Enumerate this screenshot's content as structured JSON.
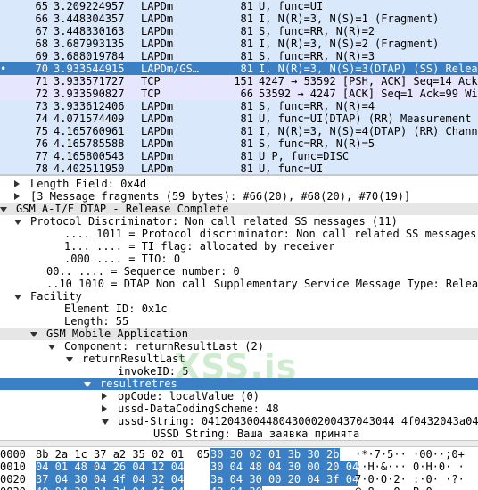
{
  "packets": [
    {
      "no": "65",
      "time": "3.209224957",
      "protocol": "LAPDm",
      "length": "81",
      "info": "U, func=UI",
      "style": "lapd"
    },
    {
      "no": "66",
      "time": "3.448304357",
      "protocol": "LAPDm",
      "length": "81",
      "info": "I, N(R)=3, N(S)=1 (Fragment)",
      "style": "lapd"
    },
    {
      "no": "67",
      "time": "3.448330163",
      "protocol": "LAPDm",
      "length": "81",
      "info": "S, func=RR, N(R)=2",
      "style": "lapd"
    },
    {
      "no": "68",
      "time": "3.687993135",
      "protocol": "LAPDm",
      "length": "81",
      "info": "I, N(R)=3, N(S)=2 (Fragment)",
      "style": "lapd"
    },
    {
      "no": "69",
      "time": "3.688019784",
      "protocol": "LAPDm",
      "length": "81",
      "info": "S, func=RR, N(R)=3",
      "style": "lapd"
    },
    {
      "no": "70",
      "time": "3.933544915",
      "protocol": "LAPDm/GS…",
      "length": "81",
      "info": "I, N(R)=3, N(S)=3(DTAP) (SS) Release Complete",
      "style": "sel",
      "mark": "•"
    },
    {
      "no": "71",
      "time": "3.933571727",
      "protocol": "TCP",
      "length": "151",
      "info": "4247 → 53592 [PSH, ACK] Seq=14 Ack=1",
      "style": "tcp"
    },
    {
      "no": "72",
      "time": "3.933590827",
      "protocol": "TCP",
      "length": "66",
      "info": "53592 → 4247 [ACK] Seq=1 Ack=99 Win=",
      "style": "tcp"
    },
    {
      "no": "73",
      "time": "3.933612406",
      "protocol": "LAPDm",
      "length": "81",
      "info": "S, func=RR, N(R)=4",
      "style": "lapd"
    },
    {
      "no": "74",
      "time": "4.071574409",
      "protocol": "LAPDm",
      "length": "81",
      "info": "U, func=UI(DTAP) (RR) Measurement Re",
      "style": "lapd"
    },
    {
      "no": "75",
      "time": "4.165760961",
      "protocol": "LAPDm",
      "length": "81",
      "info": "I, N(R)=3, N(S)=4(DTAP) (RR) Channel",
      "style": "lapd"
    },
    {
      "no": "76",
      "time": "4.165785588",
      "protocol": "LAPDm",
      "length": "81",
      "info": "S, func=RR, N(R)=5",
      "style": "lapd"
    },
    {
      "no": "77",
      "time": "4.165800543",
      "protocol": "LAPDm",
      "length": "81",
      "info": "U P, func=DISC",
      "style": "lapd"
    },
    {
      "no": "78",
      "time": "4.402511950",
      "protocol": "LAPDm",
      "length": "81",
      "info": "U, func=UI",
      "style": "lapd"
    }
  ],
  "tree": [
    {
      "indent": 16,
      "toggle": "collapsed",
      "text": "Length Field: 0x4d",
      "style": "field",
      "name": "tree-item-length-field"
    },
    {
      "indent": 16,
      "toggle": "collapsed",
      "text": "[3 Message fragments (59 bytes): #66(20), #68(20), #70(19)]",
      "style": "field",
      "name": "tree-item-message-fragments"
    },
    {
      "indent": 0,
      "toggle": "expanded",
      "text": "GSM A-I/F DTAP - Release Complete",
      "style": "sub",
      "name": "tree-item-gsm-dtap"
    },
    {
      "indent": 16,
      "toggle": "expanded",
      "text": "Protocol Discriminator: Non call related SS messages (11)",
      "style": "field",
      "name": "tree-item-protocol-discriminator"
    },
    {
      "indent": 54,
      "toggle": "none",
      "text": ".... 1011 = Protocol discriminator: Non call related SS messages (0",
      "style": "field",
      "name": "tree-item-pd-bits"
    },
    {
      "indent": 54,
      "toggle": "none",
      "text": "1... .... = TI flag: allocated by receiver",
      "style": "field",
      "name": "tree-item-ti-flag"
    },
    {
      "indent": 54,
      "toggle": "none",
      "text": ".000 .... = TIO: 0",
      "style": "field",
      "name": "tree-item-tio"
    },
    {
      "indent": 34,
      "toggle": "none",
      "text": "00.. .... = Sequence number: 0",
      "style": "field",
      "name": "tree-item-sequence-number"
    },
    {
      "indent": 34,
      "toggle": "none",
      "text": "..10 1010 = DTAP Non call Supplementary Service Message Type: Release",
      "style": "field",
      "name": "tree-item-message-type"
    },
    {
      "indent": 16,
      "toggle": "expanded",
      "text": "Facility",
      "style": "field",
      "name": "tree-item-facility"
    },
    {
      "indent": 54,
      "toggle": "none",
      "text": "Element ID: 0x1c",
      "style": "field",
      "name": "tree-item-element-id"
    },
    {
      "indent": 54,
      "toggle": "none",
      "text": "Length: 55",
      "style": "field",
      "name": "tree-item-length"
    },
    {
      "indent": 34,
      "toggle": "expanded",
      "text": "GSM Mobile Application",
      "style": "sub",
      "name": "tree-item-gsm-map"
    },
    {
      "indent": 54,
      "toggle": "expanded",
      "text": "Component: returnResultLast (2)",
      "style": "field",
      "name": "tree-item-component"
    },
    {
      "indent": 74,
      "toggle": "expanded",
      "text": "returnResultLast",
      "style": "field",
      "name": "tree-item-return-result-last"
    },
    {
      "indent": 114,
      "toggle": "none",
      "text": "invokeID: 5",
      "style": "field",
      "name": "tree-item-invoke-id"
    },
    {
      "indent": 94,
      "toggle": "expanded",
      "text": "resultretres",
      "style": "sel",
      "name": "tree-item-resultretres"
    },
    {
      "indent": 114,
      "toggle": "collapsed",
      "text": "opCode: localValue (0)",
      "style": "field",
      "name": "tree-item-opcode"
    },
    {
      "indent": 114,
      "toggle": "collapsed",
      "text": "ussd-DataCodingScheme: 48",
      "style": "field",
      "name": "tree-item-ussd-dcs"
    },
    {
      "indent": 114,
      "toggle": "expanded",
      "text": "ussd-String: 041204300448043000200437043044 4f0432043a043",
      "style": "field",
      "name": "tree-item-ussd-string"
    },
    {
      "indent": 154,
      "toggle": "none",
      "text": "USSD String: Ваша заявка принята",
      "style": "field",
      "name": "tree-item-ussd-decoded"
    }
  ],
  "watermark": "XSS.is",
  "bytes": [
    {
      "offset": "0000",
      "hex1": "8b 2a 1c 37 a2 35 02 01  05",
      "hex2": "30 30 02 01 3b 30 2b",
      "ascii": "·*·7·5·· ·00··;0+"
    },
    {
      "offset": "0010",
      "hex1": "04 01 48 04 26 04 12 04",
      "hex2": "30 04 48 04 30 00 20 04",
      "ascii": "··H·&··· 0·H·0· ·"
    },
    {
      "offset": "0020",
      "hex1": "37 04 30 04 4f 04 32 04",
      "hex2": "3a 04 30 00 20 04 3f 04",
      "ascii": "7·0·O·2· :·0· ·?·"
    },
    {
      "offset": "0030",
      "hex1": "40 04 38 04 3d 04 4f 04",
      "hex2": "42 04 30",
      "ascii": "@·8·=·O· B·0"
    }
  ]
}
